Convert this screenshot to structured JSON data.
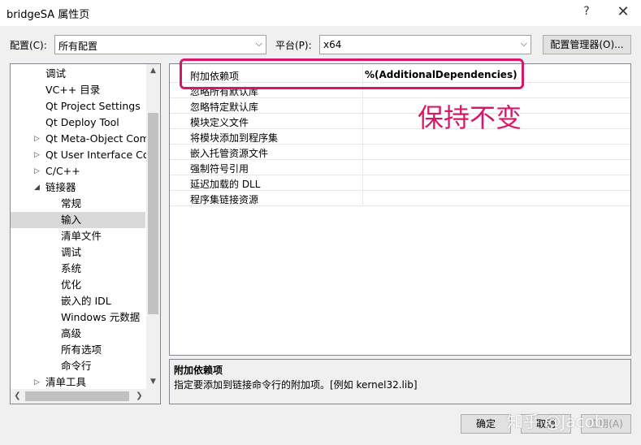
{
  "window": {
    "title": "bridgeSA 属性页",
    "help": "?",
    "close": "✕"
  },
  "toolbar": {
    "config_label": "配置(C):",
    "config_value": "所有配置",
    "platform_label": "平台(P):",
    "platform_value": "x64",
    "config_manager_button": "配置管理器(O)..."
  },
  "tree": {
    "items": [
      {
        "label": "调试",
        "expander": "",
        "selected": false
      },
      {
        "label": "VC++ 目录",
        "expander": "",
        "selected": false
      },
      {
        "label": "Qt Project Settings",
        "expander": "",
        "selected": false
      },
      {
        "label": "Qt Deploy Tool",
        "expander": "",
        "selected": false
      },
      {
        "label": "Qt Meta-Object Com",
        "expander": "▷",
        "selected": false
      },
      {
        "label": "Qt User Interface Co",
        "expander": "▷",
        "selected": false
      },
      {
        "label": "C/C++",
        "expander": "▷",
        "selected": false
      },
      {
        "label": "链接器",
        "expander": "◢",
        "selected": false
      },
      {
        "label": "常规",
        "expander": "",
        "selected": false
      },
      {
        "label": "输入",
        "expander": "",
        "selected": true
      },
      {
        "label": "清单文件",
        "expander": "",
        "selected": false
      },
      {
        "label": "调试",
        "expander": "",
        "selected": false
      },
      {
        "label": "系统",
        "expander": "",
        "selected": false
      },
      {
        "label": "优化",
        "expander": "",
        "selected": false
      },
      {
        "label": "嵌入的 IDL",
        "expander": "",
        "selected": false
      },
      {
        "label": "Windows 元数据",
        "expander": "",
        "selected": false
      },
      {
        "label": "高级",
        "expander": "",
        "selected": false
      },
      {
        "label": "所有选项",
        "expander": "",
        "selected": false
      },
      {
        "label": "命令行",
        "expander": "",
        "selected": false
      },
      {
        "label": "清单工具",
        "expander": "▷",
        "selected": false
      }
    ]
  },
  "properties": {
    "rows": [
      {
        "name": "附加依赖项",
        "value": "%(AdditionalDependencies)"
      },
      {
        "name": "忽略所有默认库",
        "value": ""
      },
      {
        "name": "忽略特定默认库",
        "value": ""
      },
      {
        "name": "模块定义文件",
        "value": ""
      },
      {
        "name": "将模块添加到程序集",
        "value": ""
      },
      {
        "name": "嵌入托管资源文件",
        "value": ""
      },
      {
        "name": "强制符号引用",
        "value": ""
      },
      {
        "name": "延迟加载的 DLL",
        "value": ""
      },
      {
        "name": "程序集链接资源",
        "value": ""
      }
    ]
  },
  "annotation": {
    "text": "保持不变",
    "color": "#d6186b"
  },
  "description": {
    "title": "附加依赖项",
    "text": "指定要添加到链接命令行的附加项。[例如 kernel32.lib]"
  },
  "buttons": {
    "ok": "确定",
    "cancel": "取消",
    "apply": "应用(A)"
  },
  "watermark": "知乎 @Jacob"
}
